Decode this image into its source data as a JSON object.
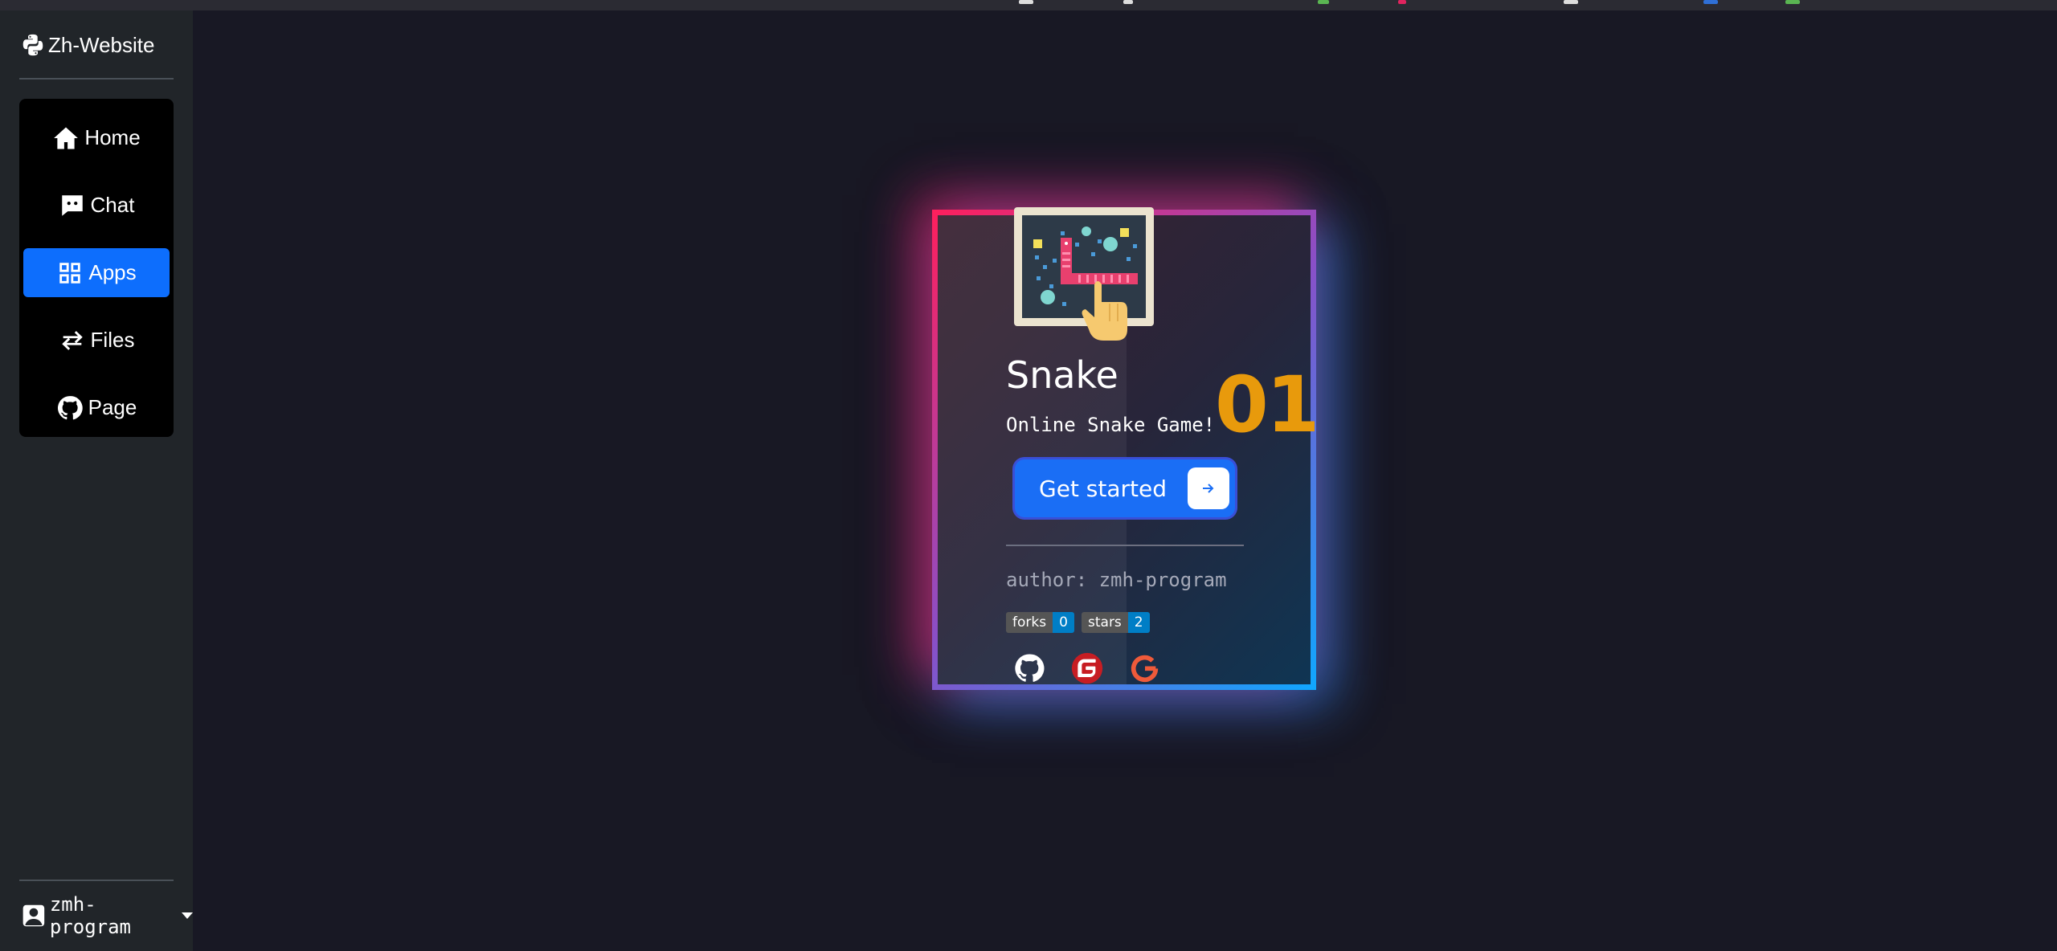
{
  "sidebar": {
    "brand": "Zh-Website",
    "nav": [
      {
        "label": "Home",
        "icon": "home-icon"
      },
      {
        "label": "Chat",
        "icon": "chat-icon"
      },
      {
        "label": "Apps",
        "icon": "apps-grid-icon",
        "active": true
      },
      {
        "label": "Files",
        "icon": "transfer-arrows-icon"
      },
      {
        "label": "Page",
        "icon": "github-icon"
      }
    ],
    "user": "zmh-program"
  },
  "card": {
    "title": "Snake",
    "number": "01",
    "description": "Online Snake Game!",
    "button_label": "Get started",
    "author": "author: zmh-program",
    "badges": [
      {
        "key": "forks",
        "value": "0"
      },
      {
        "key": "stars",
        "value": "2"
      }
    ],
    "links": [
      "github-icon",
      "gitee-icon",
      "google-icon"
    ]
  },
  "colors": {
    "accent": "#0d6efd",
    "number": "#e89a0c",
    "border_start": "#ff1f5c",
    "border_end": "#0fa7ff"
  }
}
